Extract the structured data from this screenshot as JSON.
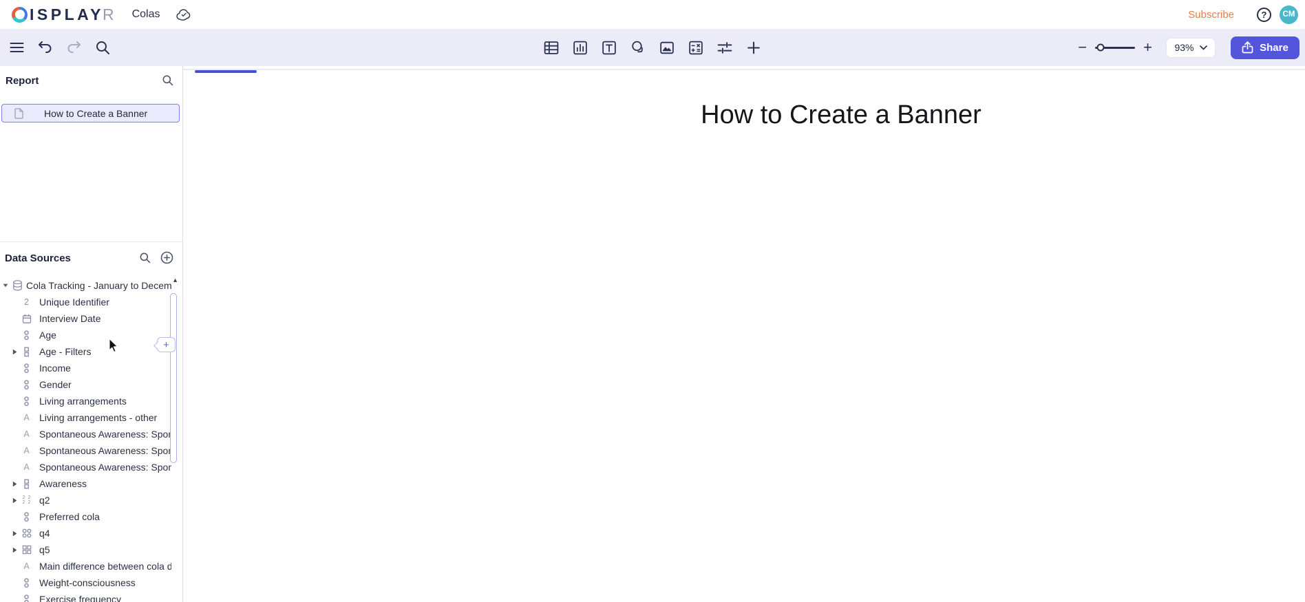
{
  "header": {
    "logo": {
      "letter_d": "D",
      "letters_mid": "ISPLAY",
      "letter_last": "R"
    },
    "document_title": "Colas",
    "subscribe_label": "Subscribe",
    "help_label": "?",
    "avatar_initials": "CM"
  },
  "toolbar": {
    "insert_icons": [
      {
        "name": "table-icon"
      },
      {
        "name": "chart-icon"
      },
      {
        "name": "text-box-icon"
      },
      {
        "name": "shape-icon"
      },
      {
        "name": "image-icon"
      },
      {
        "name": "calculation-icon"
      },
      {
        "name": "filters-icon"
      },
      {
        "name": "add-object-icon"
      }
    ],
    "zoom_value": "93%",
    "share_label": "Share"
  },
  "report_panel": {
    "title": "Report",
    "items": [
      {
        "label": "How to Create a Banner",
        "selected": true
      }
    ]
  },
  "data_sources_panel": {
    "title": "Data Sources",
    "tree": [
      {
        "label": "Cola Tracking - January to Decembe",
        "icon": "database",
        "level": 0,
        "state": "expanded"
      },
      {
        "label": "Unique Identifier",
        "icon": "numeric",
        "level": 1,
        "state": "none"
      },
      {
        "label": "Interview Date",
        "icon": "date",
        "level": 1,
        "state": "none"
      },
      {
        "label": "Age",
        "icon": "ordinal",
        "level": 1,
        "state": "none"
      },
      {
        "label": "Age - Filters",
        "icon": "variable-set",
        "level": 1,
        "state": "collapsed"
      },
      {
        "label": "Income",
        "icon": "ordinal",
        "level": 1,
        "state": "none"
      },
      {
        "label": "Gender",
        "icon": "ordinal",
        "level": 1,
        "state": "none"
      },
      {
        "label": "Living arrangements",
        "icon": "ordinal",
        "level": 1,
        "state": "none"
      },
      {
        "label": "Living arrangements - other",
        "icon": "text",
        "level": 1,
        "state": "none"
      },
      {
        "label": "Spontaneous Awareness: Sponta",
        "icon": "text",
        "level": 1,
        "state": "none"
      },
      {
        "label": "Spontaneous Awareness: Sponta",
        "icon": "text",
        "level": 1,
        "state": "none"
      },
      {
        "label": "Spontaneous Awareness: Sponta",
        "icon": "text",
        "level": 1,
        "state": "none"
      },
      {
        "label": "Awareness",
        "icon": "variable-set",
        "level": 1,
        "state": "collapsed"
      },
      {
        "label": "q2",
        "icon": "numeric-grid",
        "level": 1,
        "state": "collapsed"
      },
      {
        "label": "Preferred cola",
        "icon": "ordinal",
        "level": 1,
        "state": "none"
      },
      {
        "label": "q4",
        "icon": "nominal-grid",
        "level": 1,
        "state": "collapsed"
      },
      {
        "label": "q5",
        "icon": "binary-grid",
        "level": 1,
        "state": "collapsed"
      },
      {
        "label": "Main difference between cola dri",
        "icon": "text",
        "level": 1,
        "state": "none"
      },
      {
        "label": "Weight-consciousness",
        "icon": "ordinal",
        "level": 1,
        "state": "none"
      },
      {
        "label": "Exercise frequency",
        "icon": "ordinal",
        "level": 1,
        "state": "none"
      }
    ]
  },
  "canvas": {
    "page_title": "How to Create a Banner"
  },
  "colors": {
    "accent_purple": "#5356dd",
    "toolbar_bg": "#ebecf8",
    "subscribe_orange": "#ed7b45",
    "avatar_teal": "#47b9ca",
    "logo_navy": "#232c4e",
    "selection_purple": "#7d81ee",
    "loading_bar_blue": "#4a4fd8"
  }
}
